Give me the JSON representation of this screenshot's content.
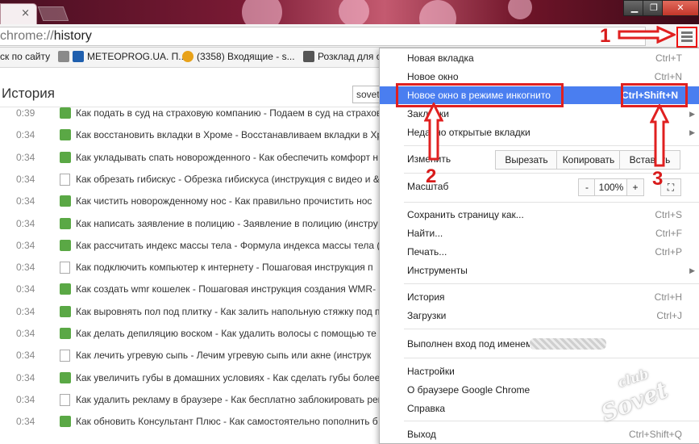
{
  "window": {
    "minimize_glyph": "▁",
    "restore_glyph": "❐",
    "close_glyph": "✕"
  },
  "tab": {
    "close_glyph": "×"
  },
  "address": {
    "scheme": "chrome://",
    "path": "history"
  },
  "bookmarks": [
    {
      "label": "ск по сайту",
      "icon": "cloud-icon",
      "color": "#8a8a8a"
    },
    {
      "label": "METEOPROG.UA. П...",
      "icon": "meteoprog-icon",
      "color": "#1f5fae"
    },
    {
      "label": "(3358) Входящие - s...",
      "icon": "mail-at-icon",
      "color": "#e8a21a"
    },
    {
      "label": "Розклад для с...",
      "icon": "train-icon",
      "color": "#555555"
    }
  ],
  "history": {
    "title": "История",
    "search_value": "sovet",
    "rows": [
      {
        "time": "0:39",
        "icon": "green",
        "text": "Как подать в суд на страховую компанию - Подаем в суд на страховую"
      },
      {
        "time": "0:34",
        "icon": "green",
        "text": "Как восстановить вкладки в Хроме - Восстанавливаем вкладки в Хроме"
      },
      {
        "time": "0:34",
        "icon": "green",
        "text": "Как укладывать спать новорожденного - Как обеспечить комфорт н"
      },
      {
        "time": "0:34",
        "icon": "page",
        "text": "Как обрезать гибискус - Обрезка гибискуса (инструкция с видео и &"
      },
      {
        "time": "0:34",
        "icon": "green",
        "text": "Как чистить новорожденному нос - Как правильно прочистить нос"
      },
      {
        "time": "0:34",
        "icon": "green",
        "text": "Как написать заявление в полицию - Заявление в полицию (инстру"
      },
      {
        "time": "0:34",
        "icon": "green",
        "text": "Как рассчитать индекс массы тела - Формула индекса массы тела ("
      },
      {
        "time": "0:34",
        "icon": "page",
        "text": "Как подключить компьютер к интернету - Пошаговая инструкция п"
      },
      {
        "time": "0:34",
        "icon": "green",
        "text": "Как создать wmr кошелек - Пошаговая инструкция создания WMR-"
      },
      {
        "time": "0:34",
        "icon": "green",
        "text": "Как выровнять пол под плитку - Как залить напольную стяжку под п"
      },
      {
        "time": "0:34",
        "icon": "green",
        "text": "Как делать депиляцию воском - Как удалить волосы с помощью те"
      },
      {
        "time": "0:34",
        "icon": "page",
        "text": "Как лечить угревую сыпь - Лечим угревую сыпь или акне (инструк"
      },
      {
        "time": "0:34",
        "icon": "green",
        "text": "Как увеличить губы в домашних условиях - Как сделать губы более"
      },
      {
        "time": "0:34",
        "icon": "page",
        "text": "Как удалить рекламу в браузере - Как бесплатно заблокировать рек"
      },
      {
        "time": "0:34",
        "icon": "green",
        "text": "Как обновить Консультант Плюс - Как самостоятельно пополнить б"
      }
    ]
  },
  "menu": {
    "new_tab": {
      "label": "Новая вкладка",
      "shortcut": "Ctrl+T"
    },
    "new_window": {
      "label": "Новое окно",
      "shortcut": "Ctrl+N"
    },
    "incognito": {
      "label": "Новое окно в режиме инкогнито",
      "shortcut": "Ctrl+Shift+N"
    },
    "bookmarks": {
      "label": "Закладки"
    },
    "recent_tabs": {
      "label": "Недавно открытые вкладки"
    },
    "edit": {
      "label": "Изменить",
      "cut": "Вырезать",
      "copy": "Копировать",
      "paste": "Вставить"
    },
    "zoom": {
      "label": "Масштаб",
      "minus": "-",
      "value": "100%",
      "plus": "+"
    },
    "save_page": {
      "label": "Сохранить страницу как...",
      "shortcut": "Ctrl+S"
    },
    "find": {
      "label": "Найти...",
      "shortcut": "Ctrl+F"
    },
    "print": {
      "label": "Печать...",
      "shortcut": "Ctrl+P"
    },
    "tools": {
      "label": "Инструменты"
    },
    "history": {
      "label": "История",
      "shortcut": "Ctrl+H"
    },
    "downloads": {
      "label": "Загрузки",
      "shortcut": "Ctrl+J"
    },
    "signed_in": {
      "label": "Выполнен вход под именем"
    },
    "settings": {
      "label": "Настройки"
    },
    "about": {
      "label": "О браузере Google Chrome"
    },
    "help": {
      "label": "Справка"
    },
    "exit": {
      "label": "Выход",
      "shortcut": "Ctrl+Shift+Q"
    }
  },
  "annotations": {
    "n1": "1",
    "n2": "2",
    "n3": "3",
    "color": "#e02020"
  },
  "watermark": {
    "line1": "club",
    "line2": "Sovet"
  }
}
